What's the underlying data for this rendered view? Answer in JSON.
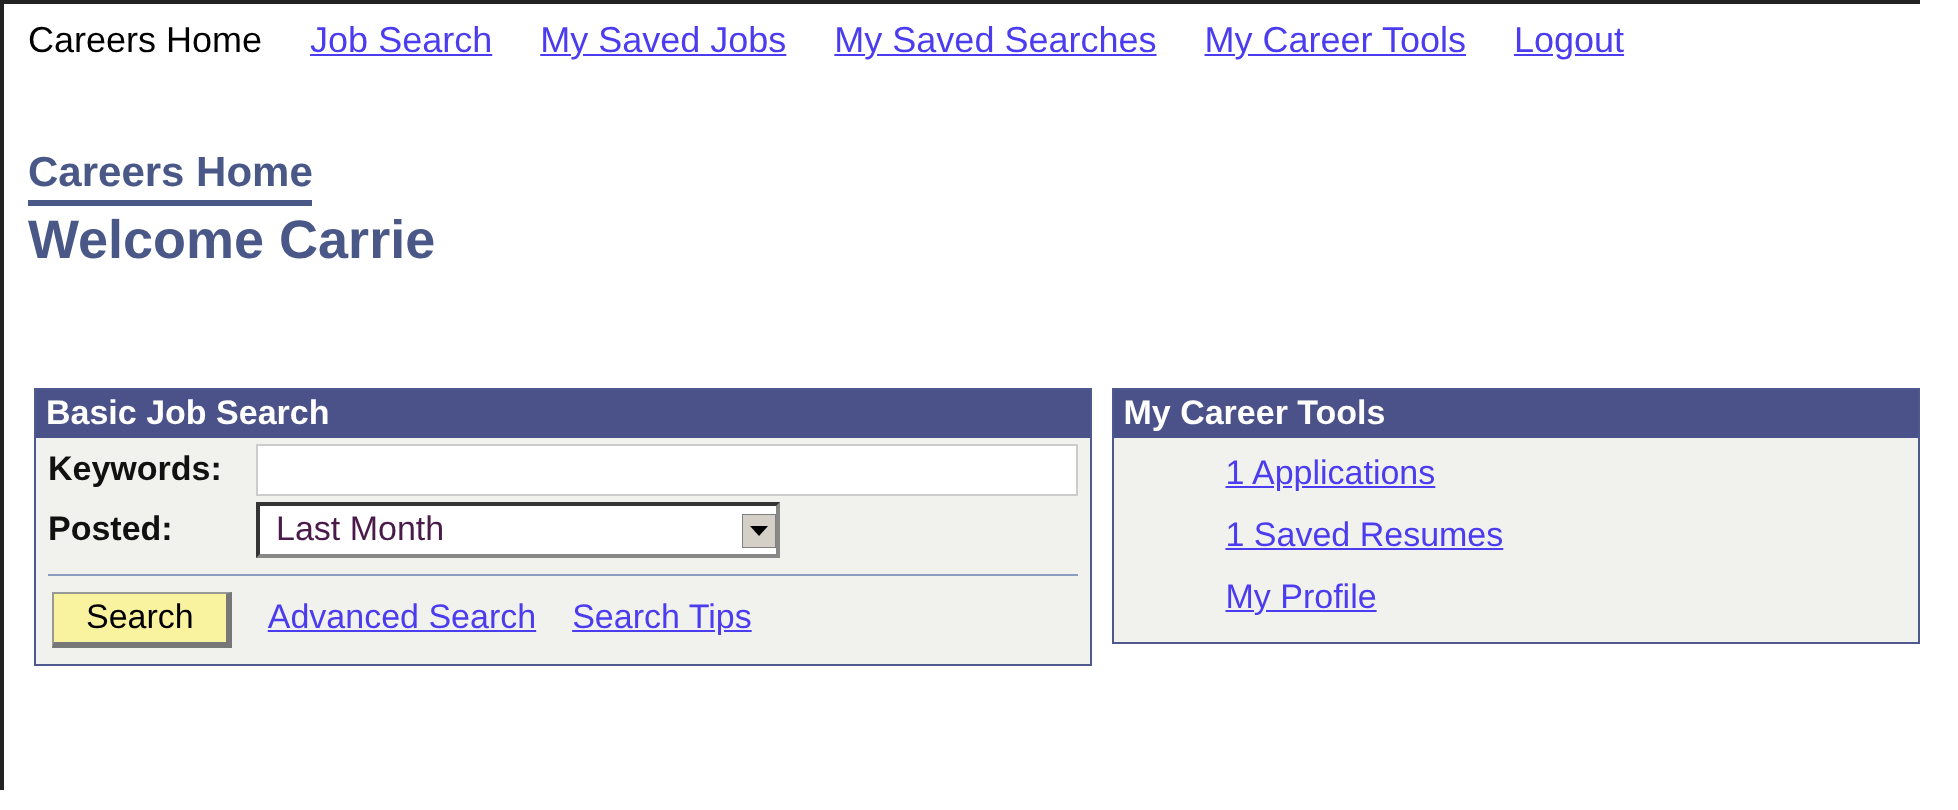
{
  "nav": [
    {
      "label": "Careers Home",
      "selected": true
    },
    {
      "label": "Job Search",
      "selected": false
    },
    {
      "label": "My Saved Jobs",
      "selected": false
    },
    {
      "label": "My Saved Searches",
      "selected": false
    },
    {
      "label": "My Career Tools",
      "selected": false
    },
    {
      "label": "Logout",
      "selected": false
    }
  ],
  "page_title": "Careers Home",
  "welcome": "Welcome Carrie",
  "basic_job_search": {
    "title": "Basic Job Search",
    "keywords_label": "Keywords:",
    "posted_label": "Posted:",
    "posted_value": "Last Month",
    "search_button": "Search",
    "links": [
      "Advanced Search",
      "Search Tips"
    ]
  },
  "career_tools": {
    "title": "My Career Tools",
    "links": [
      "1 Applications",
      "1 Saved Resumes",
      "My Profile"
    ]
  }
}
